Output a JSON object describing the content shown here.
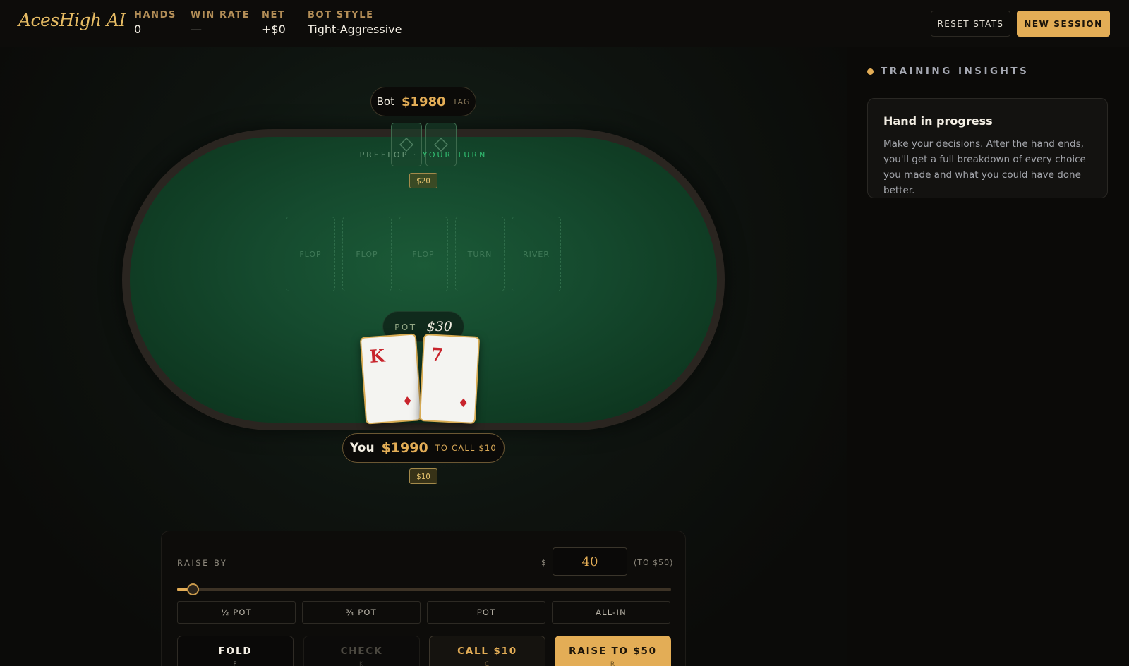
{
  "header": {
    "logo": "AcesHigh AI",
    "stats": [
      {
        "label": "HANDS",
        "value": "0"
      },
      {
        "label": "WIN RATE",
        "value": "—"
      },
      {
        "label": "NET",
        "value": "+$0"
      },
      {
        "label": "BOT STYLE",
        "value": "Tight-Aggressive"
      }
    ],
    "reset_label": "RESET STATS",
    "new_session_label": "NEW SESSION"
  },
  "table": {
    "bot": {
      "name": "Bot",
      "stack": "$1980",
      "tag": "TAG",
      "bet": "$20"
    },
    "street": "PREFLOP",
    "separator": "·",
    "turn_status": "YOUR TURN",
    "board_slots": [
      "FLOP",
      "FLOP",
      "FLOP",
      "TURN",
      "RIVER"
    ],
    "pot_label": "POT",
    "pot_value": "$30",
    "hero_cards": [
      {
        "rank": "K",
        "suit": "♦"
      },
      {
        "rank": "7",
        "suit": "♦"
      }
    ],
    "hero": {
      "name": "You",
      "stack": "$1990",
      "to_call": "TO CALL $10",
      "bet": "$10"
    }
  },
  "actions": {
    "raise_label": "RAISE BY",
    "currency": "$",
    "raise_value": "40",
    "raise_to": "(TO $50)",
    "slider_fraction": 0.02,
    "presets": [
      "½ POT",
      "¾ POT",
      "POT",
      "ALL-IN"
    ],
    "fold": {
      "label": "FOLD",
      "key": "F"
    },
    "check": {
      "label": "CHECK",
      "key": "K"
    },
    "call": {
      "label": "CALL $10",
      "key": "C"
    },
    "raise": {
      "label": "RAISE TO $50",
      "key": "R"
    }
  },
  "sidebar": {
    "title": "TRAINING INSIGHTS",
    "card_title": "Hand in progress",
    "card_text": "Make your decisions. After the hand ends, you'll get a full breakdown of every choice you made and what you could have done better."
  },
  "colors": {
    "accent": "#e3ad56",
    "felt": "#1b5a37",
    "card_red": "#c8242c"
  }
}
